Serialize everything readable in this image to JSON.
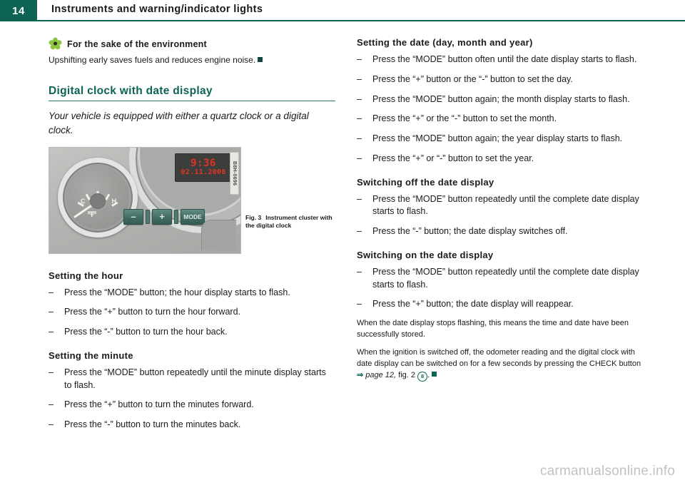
{
  "header": {
    "page_number": "14",
    "title": "Instruments and warning/indicator lights",
    "accent_color": "#0d6354"
  },
  "left_column": {
    "environment_note": {
      "icon": "flower-icon",
      "title": "For the sake of the environment",
      "body": "Upshifting early saves fuels and reduces engine noise.",
      "end_marker": "■"
    },
    "section_heading": "Digital clock with date display",
    "lead_text": "Your vehicle is equipped with either a quartz clock or a digital clock.",
    "figure": {
      "lcd_time": "9:36",
      "lcd_date": "02.11.2008",
      "side_code": "B8H-0696",
      "buttons": [
        "–",
        "+",
        "MODE"
      ],
      "gauge_cold_label": "C",
      "gauge_hot_label": "H",
      "caption_label": "Fig. 3",
      "caption_text": "Instrument cluster with the digital clock"
    },
    "sections": [
      {
        "heading": "Setting the hour",
        "items": [
          "Press the “MODE” button; the hour display starts to flash.",
          "Press the “+” button to turn the hour forward.",
          "Press the “-” button to turn the hour back."
        ]
      },
      {
        "heading": "Setting the minute",
        "items": [
          "Press the “MODE” button repeatedly until the minute display starts to flash.",
          "Press the “+” button to turn the minutes forward.",
          "Press the “-” button to turn the minutes back."
        ]
      }
    ]
  },
  "right_column": {
    "sections": [
      {
        "heading": "Setting the date (day, month and year)",
        "items": [
          "Press the “MODE” button often until the date display starts to flash.",
          "Press the “+” button or the “-” button to set the day.",
          "Press the “MODE” button again; the month display starts to flash.",
          "Press the “+” or the “-” button to set the month.",
          "Press the “MODE” button again; the year display starts to flash.",
          "Press the “+” or “-” button to set the year."
        ]
      },
      {
        "heading": "Switching off the date display",
        "items": [
          "Press the “MODE” button repeatedly until the complete date display starts to flash.",
          "Press the “-” button; the date display switches off."
        ]
      },
      {
        "heading": "Switching on the date display",
        "items": [
          "Press the “MODE” button repeatedly until the complete date display starts to flash.",
          "Press the “+” button; the date display will reappear."
        ]
      }
    ],
    "notes": [
      "When the date display stops flashing, this means the time and date have been successfully stored.",
      "When the ignition is switched off, the odometer reading and the digital clock with date display can be switched on for a few seconds by pressing the CHECK button"
    ],
    "cross_reference": {
      "arrow": "⇒",
      "target": "page 12,",
      "figure": "fig. 2",
      "marker": "8",
      "trailing": "."
    }
  },
  "footer": {
    "watermark": "carmanualsonline.info"
  }
}
